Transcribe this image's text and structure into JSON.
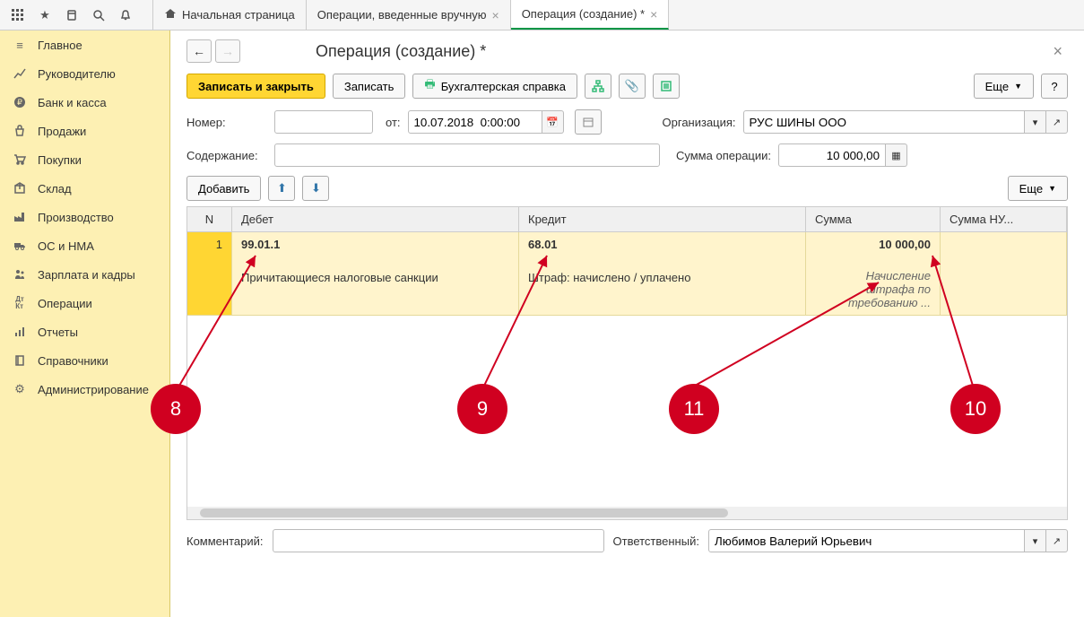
{
  "tabs": [
    {
      "label": "Начальная страница",
      "icon": "home"
    },
    {
      "label": "Операции, введенные вручную",
      "closable": true
    },
    {
      "label": "Операция (создание) *",
      "closable": true,
      "active": true
    }
  ],
  "sidebar": [
    {
      "icon": "menu",
      "label": "Главное"
    },
    {
      "icon": "chart",
      "label": "Руководителю"
    },
    {
      "icon": "ruble",
      "label": "Банк и касса"
    },
    {
      "icon": "bag",
      "label": "Продажи"
    },
    {
      "icon": "cart",
      "label": "Покупки"
    },
    {
      "icon": "box",
      "label": "Склад"
    },
    {
      "icon": "factory",
      "label": "Производство"
    },
    {
      "icon": "truck",
      "label": "ОС и НМА"
    },
    {
      "icon": "people",
      "label": "Зарплата и кадры"
    },
    {
      "icon": "dtkt",
      "label": "Операции"
    },
    {
      "icon": "bars",
      "label": "Отчеты"
    },
    {
      "icon": "book",
      "label": "Справочники"
    },
    {
      "icon": "gear",
      "label": "Администрирование"
    }
  ],
  "page": {
    "title": "Операция (создание) *",
    "save_close": "Записать и закрыть",
    "save": "Записать",
    "accounting_ref": "Бухгалтерская справка",
    "more": "Еще",
    "help": "?",
    "number_label": "Номер:",
    "number_value": "",
    "from_label": "от:",
    "date_value": "10.07.2018  0:00:00",
    "org_label": "Организация:",
    "org_value": "РУС ШИНЫ ООО",
    "content_label": "Содержание:",
    "content_value": "",
    "opsum_label": "Сумма операции:",
    "opsum_value": "10 000,00",
    "add_btn": "Добавить",
    "table": {
      "headers": {
        "n": "N",
        "debit": "Дебет",
        "credit": "Кредит",
        "sum": "Сумма",
        "sumnu": "Сумма НУ..."
      },
      "row": {
        "n": "1",
        "debit_acc": "99.01.1",
        "debit_sub": "Причитающиеся налоговые санкции",
        "credit_acc": "68.01",
        "credit_sub": "Штраф: начислено / уплачено",
        "sum": "10 000,00",
        "sum_note": "Начисление штрафа по требованию ..."
      }
    },
    "comment_label": "Комментарий:",
    "comment_value": "",
    "responsible_label": "Ответственный:",
    "responsible_value": "Любимов Валерий Юрьевич"
  },
  "annotations": {
    "a8": "8",
    "a9": "9",
    "a10": "10",
    "a11": "11"
  }
}
